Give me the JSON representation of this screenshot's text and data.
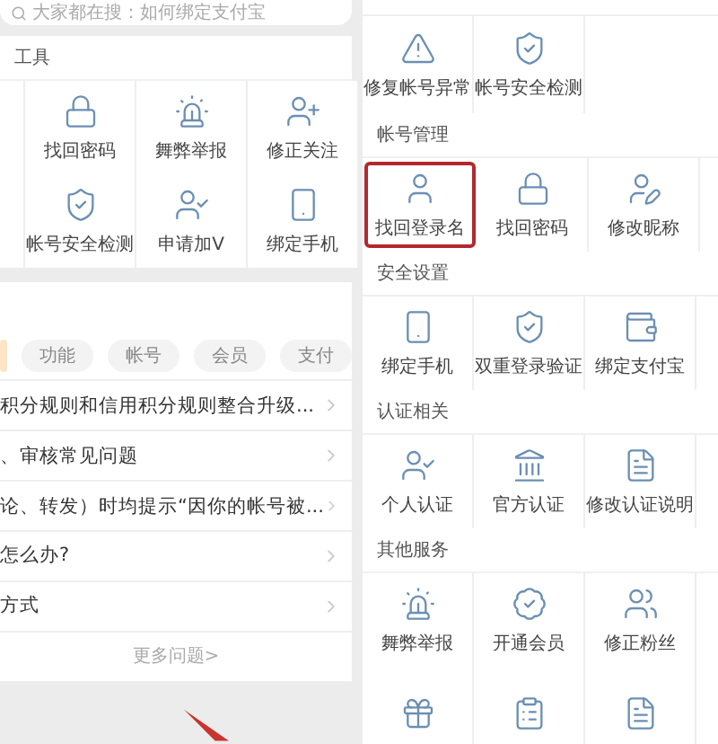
{
  "left": {
    "search": {
      "placeholder": "大家都在搜：如何绑定支付宝"
    },
    "tools": {
      "title": "工具",
      "rows": [
        [
          {
            "label": "找回密码",
            "kind": "lock"
          },
          {
            "label": "舞弊举报",
            "kind": "siren"
          },
          {
            "label": "修正关注",
            "kind": "userplus"
          }
        ],
        [
          {
            "label": "帐号安全检测",
            "kind": "shield"
          },
          {
            "label": "申请加V",
            "kind": "usercheck"
          },
          {
            "label": "绑定手机",
            "kind": "phone"
          }
        ]
      ]
    },
    "faq": {
      "tabs": [
        {
          "selected": true
        },
        {
          "label": "功能",
          "selected": false
        },
        {
          "label": "帐号",
          "selected": false
        },
        {
          "label": "会员",
          "selected": false
        },
        {
          "label": "支付",
          "selected": false
        }
      ],
      "questions": [
        "积分规则和信用积分规则整合升级...",
        "、审核常见问题",
        "论、转发）时均提示“因你的帐号被...",
        "怎么办?",
        "方式"
      ],
      "more": "更多问题>"
    }
  },
  "right": {
    "sections": [
      {
        "items": [
          {
            "label": "修复帐号异常",
            "kind": "warning",
            "highlighted": false
          },
          {
            "label": "帐号安全检测",
            "kind": "shield",
            "highlighted": false
          }
        ]
      },
      {
        "title": "帐号管理",
        "items": [
          {
            "label": "找回登录名",
            "kind": "user",
            "highlighted": true
          },
          {
            "label": "找回密码",
            "kind": "lock",
            "highlighted": false
          },
          {
            "label": "修改昵称",
            "kind": "useredit",
            "highlighted": false
          }
        ]
      },
      {
        "title": "安全设置",
        "items": [
          {
            "label": "绑定手机",
            "kind": "phone",
            "highlighted": false
          },
          {
            "label": "双重登录验证",
            "kind": "shield",
            "highlighted": false
          },
          {
            "label": "绑定支付宝",
            "kind": "wallet",
            "highlighted": false
          }
        ]
      },
      {
        "title": "认证相关",
        "items": [
          {
            "label": "个人认证",
            "kind": "usercheck",
            "highlighted": false
          },
          {
            "label": "官方认证",
            "kind": "bank",
            "highlighted": false
          },
          {
            "label": "修改认证说明",
            "kind": "doc",
            "highlighted": false
          }
        ]
      },
      {
        "title": "其他服务",
        "items": [
          {
            "label": "舞弊举报",
            "kind": "siren",
            "highlighted": false
          },
          {
            "label": "开通会员",
            "kind": "badge",
            "highlighted": false
          },
          {
            "label": "修正粉丝",
            "kind": "users",
            "highlighted": false
          }
        ]
      },
      {
        "items": [
          {
            "kind": "gift",
            "highlighted": false
          },
          {
            "kind": "clipboard",
            "highlighted": false
          },
          {
            "kind": "doc",
            "highlighted": false
          }
        ]
      }
    ]
  }
}
